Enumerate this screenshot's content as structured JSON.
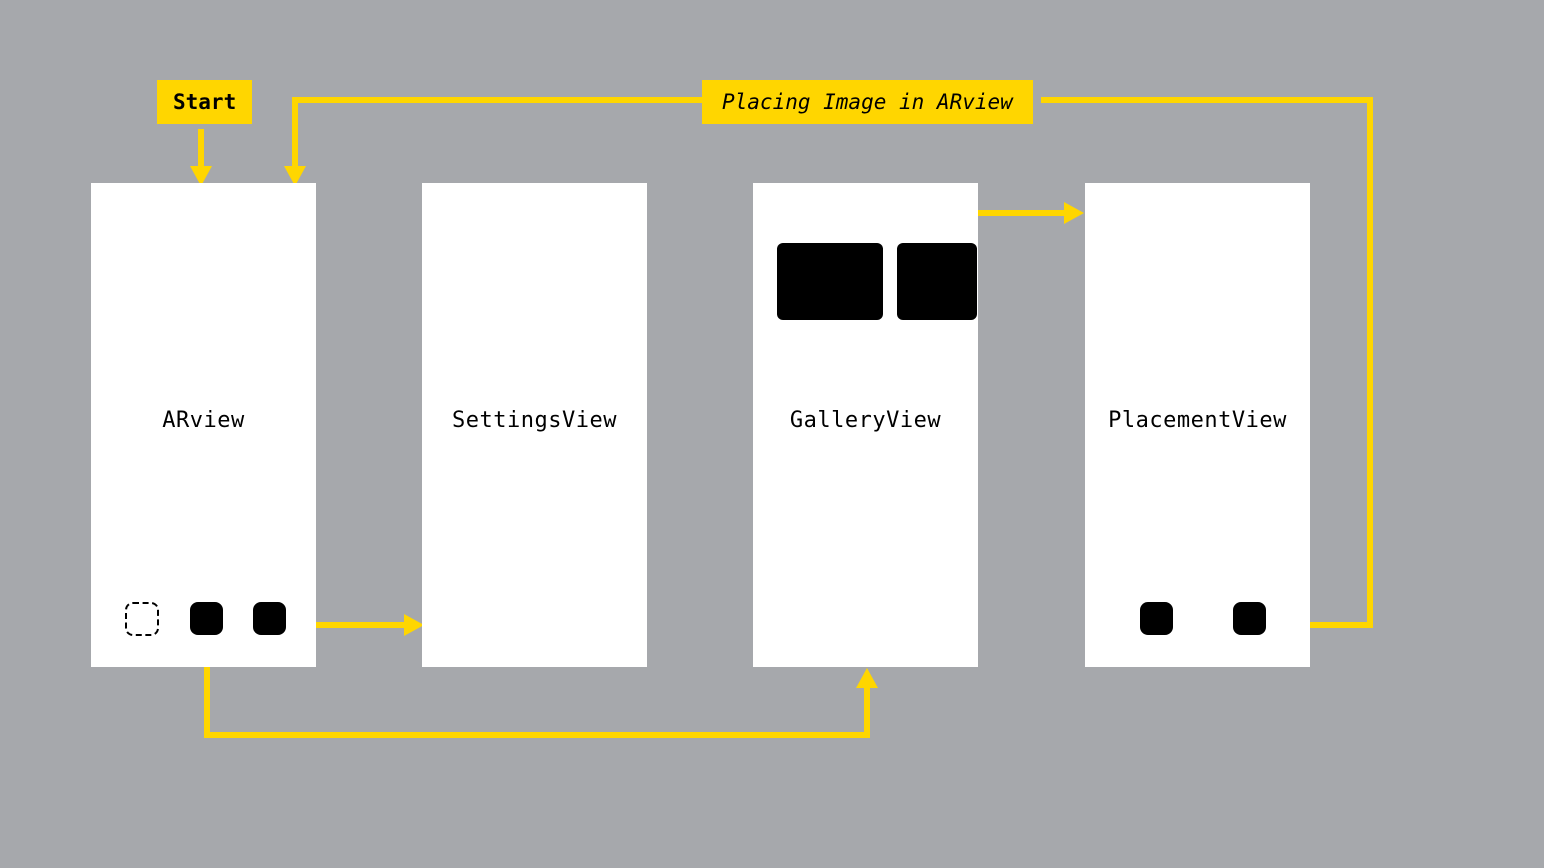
{
  "labels": {
    "start": "Start",
    "banner": "Placing Image in ARview"
  },
  "panels": {
    "arview": {
      "title": "ARview"
    },
    "settings": {
      "title": "SettingsView"
    },
    "gallery": {
      "title": "GalleryView"
    },
    "placement": {
      "title": "PlacementView"
    }
  },
  "colors": {
    "accent": "#ffd600",
    "panel": "#ffffff",
    "bg": "#a6a8ac",
    "ink": "#000000"
  }
}
